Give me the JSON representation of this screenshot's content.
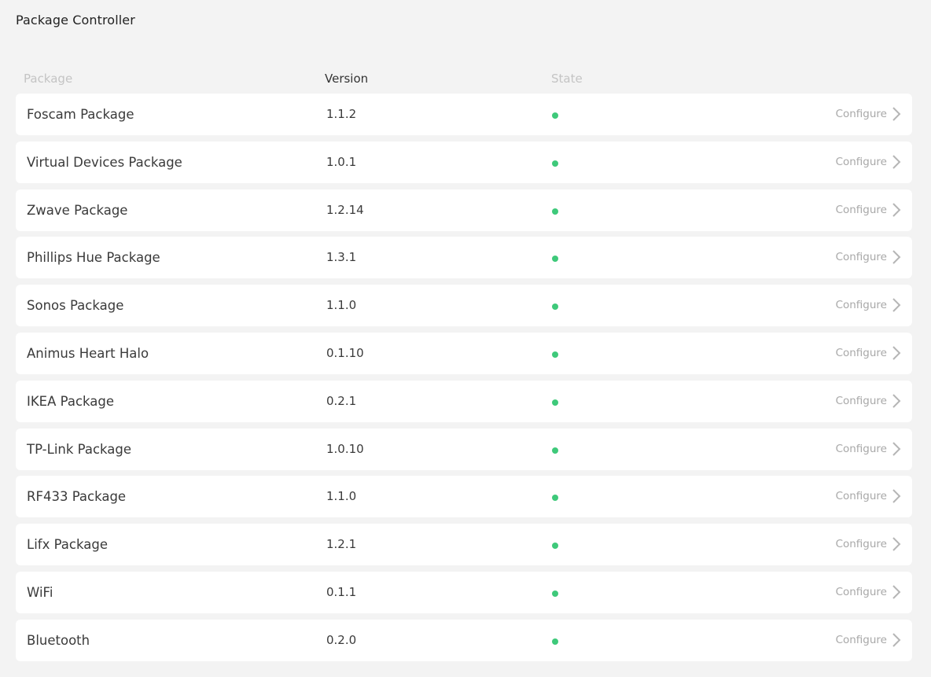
{
  "page": {
    "title": "Package Controller"
  },
  "table": {
    "headers": {
      "package": "Package",
      "version": "Version",
      "state": "State"
    },
    "configure_label": "Configure",
    "state_color": "#3ec97a",
    "rows": [
      {
        "name": "Foscam Package",
        "version": "1.1.2",
        "configure": "Configure"
      },
      {
        "name": "Virtual Devices Package",
        "version": "1.0.1",
        "configure": "Configure"
      },
      {
        "name": "Zwave Package",
        "version": "1.2.14",
        "configure": "Configure"
      },
      {
        "name": "Phillips Hue Package",
        "version": "1.3.1",
        "configure": "Configure"
      },
      {
        "name": "Sonos Package",
        "version": "1.1.0",
        "configure": "Configure"
      },
      {
        "name": "Animus Heart Halo",
        "version": "0.1.10",
        "configure": "Configure"
      },
      {
        "name": "IKEA Package",
        "version": "0.2.1",
        "configure": "Configure"
      },
      {
        "name": "TP-Link Package",
        "version": "1.0.10",
        "configure": "Configure"
      },
      {
        "name": "RF433 Package",
        "version": "1.1.0",
        "configure": "Configure"
      },
      {
        "name": "Lifx Package",
        "version": "1.2.1",
        "configure": "Configure"
      },
      {
        "name": "WiFi",
        "version": "0.1.1",
        "configure": "Configure"
      },
      {
        "name": "Bluetooth",
        "version": "0.2.0",
        "configure": "Configure"
      }
    ]
  },
  "icons": {
    "state": "status-dot-icon",
    "configure": "chevron-right-icon"
  }
}
